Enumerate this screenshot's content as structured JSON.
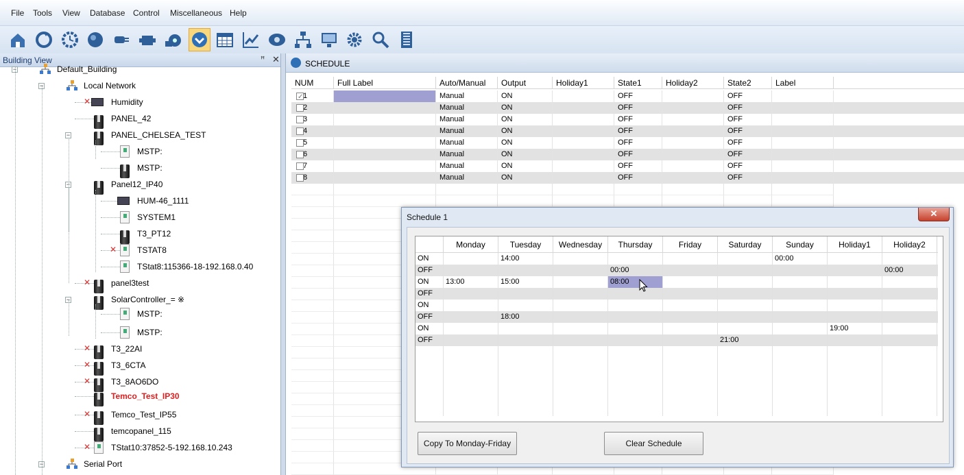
{
  "menu": [
    "File",
    "Tools",
    "View",
    "Database",
    "Control",
    "Miscellaneous",
    "Help"
  ],
  "toolbar": {
    "icons": [
      "building-home-icon",
      "refresh-icon",
      "clock-icon",
      "dial-icon",
      "output-plug-icon",
      "network-icon",
      "fan-icon",
      "schedule-icon",
      "calendar-icon",
      "trend-chart-icon",
      "alarm-icon",
      "topology-icon",
      "monitor-icon",
      "settings-gear-icon",
      "search-icon",
      "building-tower-icon"
    ],
    "active_index": 7
  },
  "building_view": {
    "title": "Building View",
    "pin": "ꟸ",
    "close": "✕",
    "nodes": [
      {
        "label": "Default_Building",
        "icon": "network",
        "x": 0
      },
      {
        "label": "Local Network",
        "icon": "network",
        "x": 1
      },
      {
        "label": "Humidity",
        "icon": "hum",
        "x": 2,
        "err": true
      },
      {
        "label": "PANEL_42",
        "icon": "panel",
        "x": 2
      },
      {
        "label": "PANEL_CHELSEA_TEST",
        "icon": "panel",
        "x": 2
      },
      {
        "label": "MSTP:",
        "icon": "tstat",
        "x": 3
      },
      {
        "label": "MSTP:",
        "icon": "panel",
        "x": 3
      },
      {
        "label": "Panel12_IP40",
        "icon": "panel",
        "x": 2
      },
      {
        "label": "HUM-46_1111",
        "icon": "hum",
        "x": 3
      },
      {
        "label": "SYSTEM1",
        "icon": "tstat",
        "x": 3
      },
      {
        "label": "T3_PT12",
        "icon": "panel",
        "x": 3
      },
      {
        "label": "TSTAT8",
        "icon": "tstat",
        "x": 3,
        "err": true
      },
      {
        "label": "TStat8:115366-18-192.168.0.40",
        "icon": "tstat",
        "x": 3
      },
      {
        "label": "panel3test",
        "icon": "panel",
        "x": 2,
        "err": true
      },
      {
        "label": "SolarController_= ※",
        "icon": "panel",
        "x": 2
      },
      {
        "label": "MSTP:",
        "icon": "tstat",
        "x": 3
      },
      {
        "label": "MSTP:",
        "icon": "tstat",
        "x": 3
      },
      {
        "label": "T3_22AI",
        "icon": "panel",
        "x": 2,
        "err": true
      },
      {
        "label": "T3_6CTA",
        "icon": "panel",
        "x": 2,
        "err": true
      },
      {
        "label": "T3_8AO6DO",
        "icon": "panel",
        "x": 2,
        "err": true
      },
      {
        "label": "Temco_Test_IP30",
        "icon": "panel",
        "x": 2,
        "hl": true
      },
      {
        "label": "Temco_Test_IP55",
        "icon": "panel",
        "x": 2,
        "err": true
      },
      {
        "label": "temcopanel_115",
        "icon": "panel",
        "x": 2
      },
      {
        "label": "TStat10:37852-5-192.168.10.243",
        "icon": "tstat",
        "x": 2,
        "err": true
      },
      {
        "label": "Serial Port",
        "icon": "network",
        "x": 1
      }
    ]
  },
  "schedule": {
    "title": "SCHEDULE",
    "headers": [
      "NUM",
      "Full Label",
      "Auto/Manual",
      "Output",
      "Holiday1",
      "State1",
      "Holiday2",
      "State2",
      "Label"
    ],
    "rows": [
      {
        "num": "1",
        "label": "",
        "mode": "Manual",
        "output": "ON",
        "h1": "",
        "s1": "OFF",
        "h2": "",
        "s2": "OFF",
        "lbl": "",
        "checked": true
      },
      {
        "num": "2",
        "label": "",
        "mode": "Manual",
        "output": "ON",
        "h1": "",
        "s1": "OFF",
        "h2": "",
        "s2": "OFF",
        "lbl": ""
      },
      {
        "num": "3",
        "label": "",
        "mode": "Manual",
        "output": "ON",
        "h1": "",
        "s1": "OFF",
        "h2": "",
        "s2": "OFF",
        "lbl": ""
      },
      {
        "num": "4",
        "label": "",
        "mode": "Manual",
        "output": "ON",
        "h1": "",
        "s1": "OFF",
        "h2": "",
        "s2": "OFF",
        "lbl": ""
      },
      {
        "num": "5",
        "label": "",
        "mode": "Manual",
        "output": "ON",
        "h1": "",
        "s1": "OFF",
        "h2": "",
        "s2": "OFF",
        "lbl": ""
      },
      {
        "num": "6",
        "label": "",
        "mode": "Manual",
        "output": "ON",
        "h1": "",
        "s1": "OFF",
        "h2": "",
        "s2": "OFF",
        "lbl": ""
      },
      {
        "num": "7",
        "label": "",
        "mode": "Manual",
        "output": "ON",
        "h1": "",
        "s1": "OFF",
        "h2": "",
        "s2": "OFF",
        "lbl": ""
      },
      {
        "num": "8",
        "label": "",
        "mode": "Manual",
        "output": "ON",
        "h1": "",
        "s1": "OFF",
        "h2": "",
        "s2": "OFF",
        "lbl": ""
      }
    ]
  },
  "dialog": {
    "title": "Schedule 1",
    "close": "✕",
    "days": [
      "Monday",
      "Tuesday",
      "Wednesday",
      "Thursday",
      "Friday",
      "Saturday",
      "Sunday",
      "Holiday1",
      "Holiday2"
    ],
    "rows": [
      {
        "state": "ON",
        "times": [
          "",
          "14:00",
          "",
          "",
          "",
          "",
          "00:00",
          "",
          ""
        ]
      },
      {
        "state": "OFF",
        "times": [
          "",
          "",
          "",
          "00:00",
          "",
          "",
          "",
          "",
          "00:00"
        ]
      },
      {
        "state": "ON",
        "times": [
          "13:00",
          "15:00",
          "",
          "08:00",
          "",
          "",
          "",
          "",
          ""
        ]
      },
      {
        "state": "OFF",
        "times": [
          "",
          "",
          "",
          "",
          "",
          "",
          "",
          "",
          ""
        ]
      },
      {
        "state": "ON",
        "times": [
          "",
          "",
          "",
          "",
          "",
          "",
          "",
          "",
          ""
        ]
      },
      {
        "state": "OFF",
        "times": [
          "",
          "18:00",
          "",
          "",
          "",
          "",
          "",
          "",
          ""
        ]
      },
      {
        "state": "ON",
        "times": [
          "",
          "",
          "",
          "",
          "",
          "",
          "",
          "19:00",
          ""
        ]
      },
      {
        "state": "OFF",
        "times": [
          "",
          "",
          "",
          "",
          "",
          "21:00",
          "",
          "",
          ""
        ]
      }
    ],
    "copy_button": "Copy To Monday-Friday",
    "clear_button": "Clear   Schedule"
  },
  "colors": {
    "selection": "#9f9fd2",
    "row_alt": "#e2e2e2",
    "error": "#e03030",
    "highlight": "#e02020"
  }
}
